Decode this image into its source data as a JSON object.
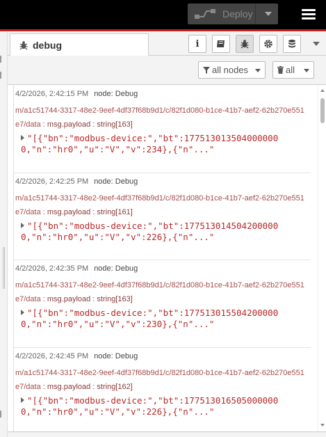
{
  "header": {
    "deploy_label": "Deploy"
  },
  "sidebar_tab": {
    "label": "debug",
    "icon": "bug-icon"
  },
  "sidebar_buttons": [
    {
      "name": "info-icon",
      "glyph": "i"
    },
    {
      "name": "book-icon",
      "glyph": "▤"
    },
    {
      "name": "bug-icon",
      "glyph": "✱"
    },
    {
      "name": "gear-icon",
      "glyph": "⚙"
    },
    {
      "name": "database-icon",
      "glyph": "≡"
    }
  ],
  "filters": {
    "nodes_label": "all nodes",
    "clear_label": "all"
  },
  "messages": [
    {
      "timestamp": "4/2/2026, 2:42:15 PM",
      "node": "node: Debug",
      "topic": "m/a1c51744-3317-48e2-9eef-4df37f68b9d1/c/82f1d080-b1ce-41b7-aef2-62b270e551e7/data",
      "type": " : msg.payload : string[163]",
      "payload": "\"[{\"bn\":\"modbus-device:\",\"bt\":1775130135040000000,\"n\":\"hr0\",\"u\":\"V\",\"v\":234},{\"n\"...\""
    },
    {
      "timestamp": "4/2/2026, 2:42:25 PM",
      "node": "node: Debug",
      "topic": "m/a1c51744-3317-48e2-9eef-4df37f68b9d1/c/82f1d080-b1ce-41b7-aef2-62b270e551e7/data",
      "type": " : msg.payload : string[161]",
      "payload": "\"[{\"bn\":\"modbus-device:\",\"bt\":1775130145042000000,\"n\":\"hr0\",\"u\":\"V\",\"v\":226},{\"n\"...\""
    },
    {
      "timestamp": "4/2/2026, 2:42:35 PM",
      "node": "node: Debug",
      "topic": "m/a1c51744-3317-48e2-9eef-4df37f68b9d1/c/82f1d080-b1ce-41b7-aef2-62b270e551e7/data",
      "type": " : msg.payload : string[163]",
      "payload": "\"[{\"bn\":\"modbus-device:\",\"bt\":1775130155042000000,\"n\":\"hr0\",\"u\":\"V\",\"v\":230},{\"n\"...\""
    },
    {
      "timestamp": "4/2/2026, 2:42:45 PM",
      "node": "node: Debug",
      "topic": "m/a1c51744-3317-48e2-9eef-4df37f68b9d1/c/82f1d080-b1ce-41b7-aef2-62b270e551e7/data",
      "type": " : msg.payload : string[162]",
      "payload": "\"[{\"bn\":\"modbus-device:\",\"bt\":1775130165050000000,\"n\":\"hr0\",\"u\":\"V\",\"v\":226},{\"n\"...\""
    }
  ]
}
